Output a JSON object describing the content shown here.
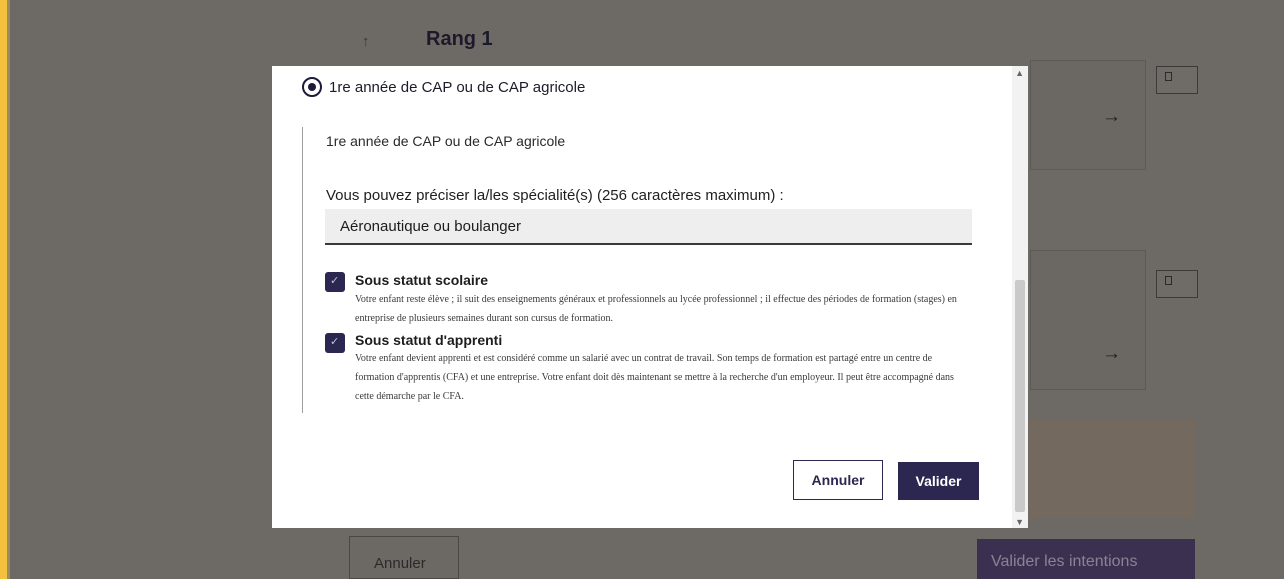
{
  "background": {
    "rank_title": "Rang 1",
    "cancel_label": "Annuler",
    "validate_label": "Valider les intentions"
  },
  "modal": {
    "option_label": "1re année de CAP ou de CAP agricole",
    "section_title": "1re année de CAP ou de CAP agricole",
    "specialty_label": "Vous pouvez préciser la/les spécialité(s) (256 caractères maximum) :",
    "specialty_value": "Aéronautique ou boulanger",
    "checkboxes": [
      {
        "title": "Sous statut scolaire",
        "checked": true,
        "description": "Votre enfant reste élève ; il suit des enseignements généraux et professionnels au lycée professionnel ; il effectue des périodes de formation (stages) en entreprise de plusieurs semaines durant son cursus de formation."
      },
      {
        "title": "Sous statut d'apprenti",
        "checked": true,
        "description": "Votre enfant devient apprenti et est considéré comme un salarié avec un contrat de travail. Son temps de formation est partagé entre un centre de formation d'apprentis (CFA) et une entreprise. Votre enfant doit dès maintenant se mettre à la recherche d'un employeur. Il peut être accompagné dans cette démarche par le CFA."
      }
    ],
    "cancel_label": "Annuler",
    "validate_label": "Valider"
  },
  "colors": {
    "overlay": "#6d6a66",
    "accent": "#2c2750",
    "left_stripe": "#f3c13d"
  }
}
